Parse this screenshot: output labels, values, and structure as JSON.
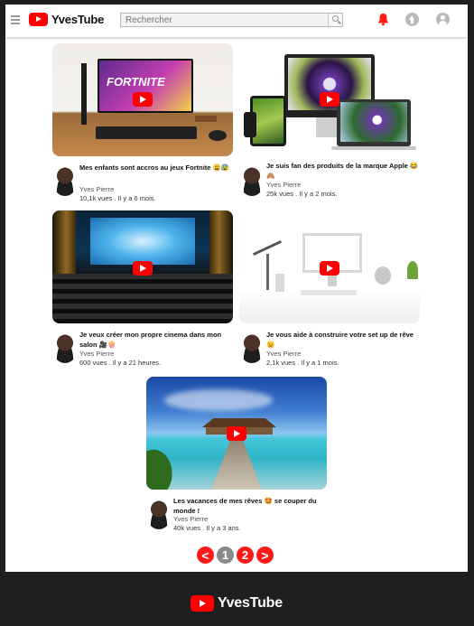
{
  "header": {
    "logo_text": "YvesTube",
    "search_placeholder": "Rechercher"
  },
  "videos": [
    {
      "title": "Mes enfants sont accros au jeux Fortnite 😩😰",
      "channel": "Yves Pierre",
      "views": "10,1k vues .",
      "age": "Il y a 6 mois.",
      "thumb_text": "FORTNITE"
    },
    {
      "title": "Je suis fan des produits de la marque Apple 😂🙈",
      "channel": "Yves Pierre",
      "views": "25k vues .",
      "age": "Il y a 2 mois."
    },
    {
      "title": "Je veux créer mon propre cinema dans mon salon 🎥🍿",
      "channel": "Yves Pierre",
      "views": "600 vues .",
      "age": "Il y a 21 heures."
    },
    {
      "title": "Je vous aide à construire votre set up de rêve 😉",
      "channel": "Yves Pierre",
      "views": "2,1k vues .",
      "age": "Il y a 1 mois."
    },
    {
      "title": "Les vacances de mes rêves 🤩 se couper du monde !",
      "channel": "Yves Pierre",
      "views": "40k vues .",
      "age": "Il y a 3 ans."
    }
  ],
  "pagination": {
    "prev": "<",
    "pages": [
      "1",
      "2"
    ],
    "next": ">",
    "current": "2"
  },
  "footer": {
    "logo_text": "YvesTube"
  }
}
